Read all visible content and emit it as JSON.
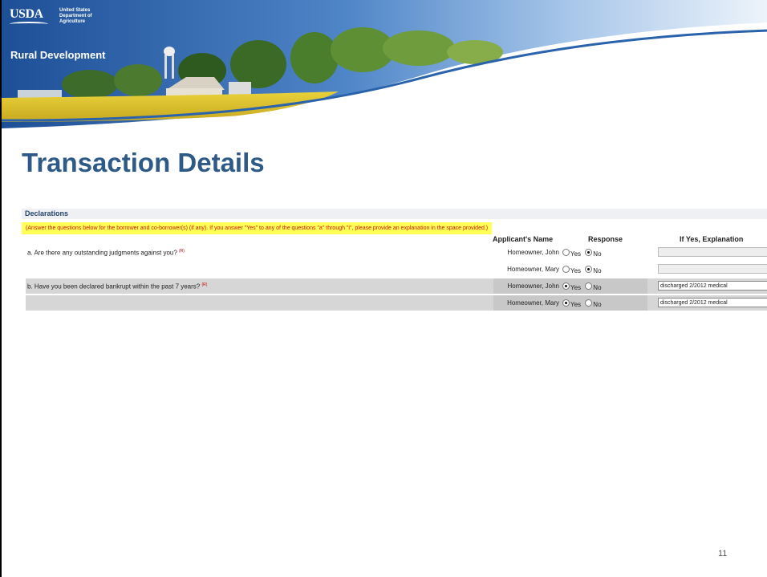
{
  "header": {
    "agency_short": "USDA",
    "agency_lines": [
      "United States",
      "Department of",
      "Agriculture"
    ],
    "mission_area": "Rural Development"
  },
  "page": {
    "title": "Transaction Details",
    "number": "11"
  },
  "declarations": {
    "section_title": "Declarations",
    "instructions": "(Answer the questions below for the borrower and co-borrower(s) (if any). If you answer \"Yes\" to any of the questions \"a\" through \"i\", please provide an explanation in the space provided.)",
    "columns": {
      "applicant": "Applicant's Name",
      "response": "Response",
      "explanation": "If Yes, Explanation"
    },
    "required_marker": "(R)",
    "yes_label": "Yes",
    "no_label": "No",
    "rows": [
      {
        "question": "a. Are there any outstanding judgments against you?",
        "applicant": "Homeowner, John",
        "answer": "No",
        "explanation": ""
      },
      {
        "question": "",
        "applicant": "Homeowner, Mary",
        "answer": "No",
        "explanation": ""
      },
      {
        "question": "b. Have you been declared bankrupt within the past 7 years?",
        "applicant": "Homeowner, John",
        "answer": "Yes",
        "explanation": "discharged 2/2012 medical"
      },
      {
        "question": "",
        "applicant": "Homeowner, Mary",
        "answer": "Yes",
        "explanation": "discharged 2/2012 medical"
      }
    ]
  },
  "colors": {
    "title_blue": "#2e5a88",
    "instruction_bg": "#ffff55",
    "instruction_text": "#d01818",
    "banner_blue": "#1f4f93"
  }
}
